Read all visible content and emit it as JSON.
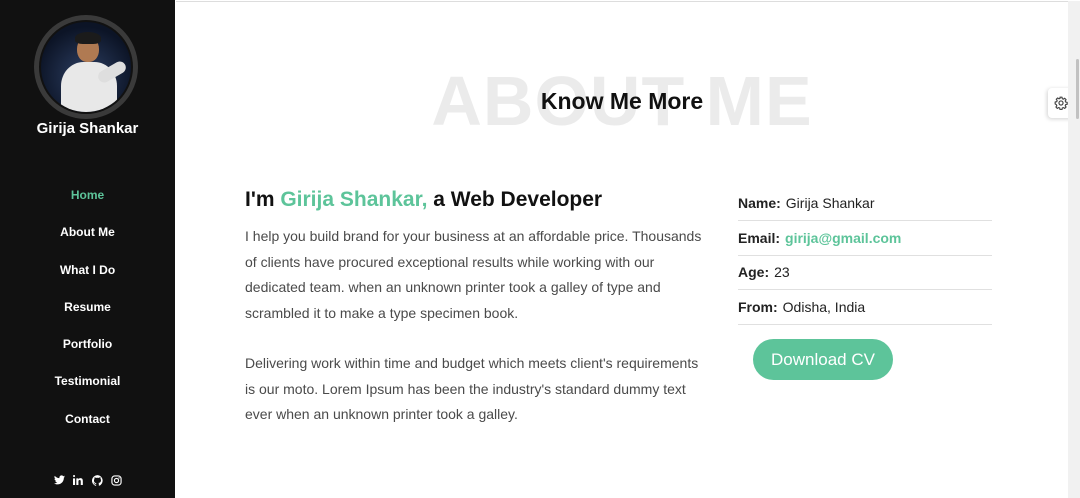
{
  "profile": {
    "name": "Girija Shankar"
  },
  "nav": {
    "items": [
      {
        "label": "Home",
        "active": true
      },
      {
        "label": "About Me",
        "active": false
      },
      {
        "label": "What I Do",
        "active": false
      },
      {
        "label": "Resume",
        "active": false
      },
      {
        "label": "Portfolio",
        "active": false
      },
      {
        "label": "Testimonial",
        "active": false
      },
      {
        "label": "Contact",
        "active": false
      }
    ]
  },
  "socials": [
    "twitter-icon",
    "linkedin-icon",
    "github-icon",
    "instagram-icon"
  ],
  "about": {
    "bg_title": "ABOUT ME",
    "title": "Know Me More",
    "heading_prefix": "I'm ",
    "heading_name": "Girija Shankar,",
    "heading_suffix": " a Web Developer",
    "paragraph1": "I help you build brand for your business at an affordable price. Thousands of clients have procured exceptional results while working with our dedicated team. when an unknown printer took a galley of type and scrambled it to make a type specimen book.",
    "paragraph2": "Delivering work within time and budget which meets client's requirements is our moto. Lorem Ipsum has been the industry's standard dummy text ever when an unknown printer took a galley."
  },
  "info": {
    "name_label": "Name:",
    "name_value": "Girija Shankar",
    "email_label": "Email:",
    "email_value": "girija@gmail.com",
    "age_label": "Age:",
    "age_value": "23",
    "from_label": "From:",
    "from_value": "Odisha, India"
  },
  "download_cv_label": "Download CV",
  "colors": {
    "accent": "#5dc49a",
    "sidebar_bg": "#111111"
  }
}
